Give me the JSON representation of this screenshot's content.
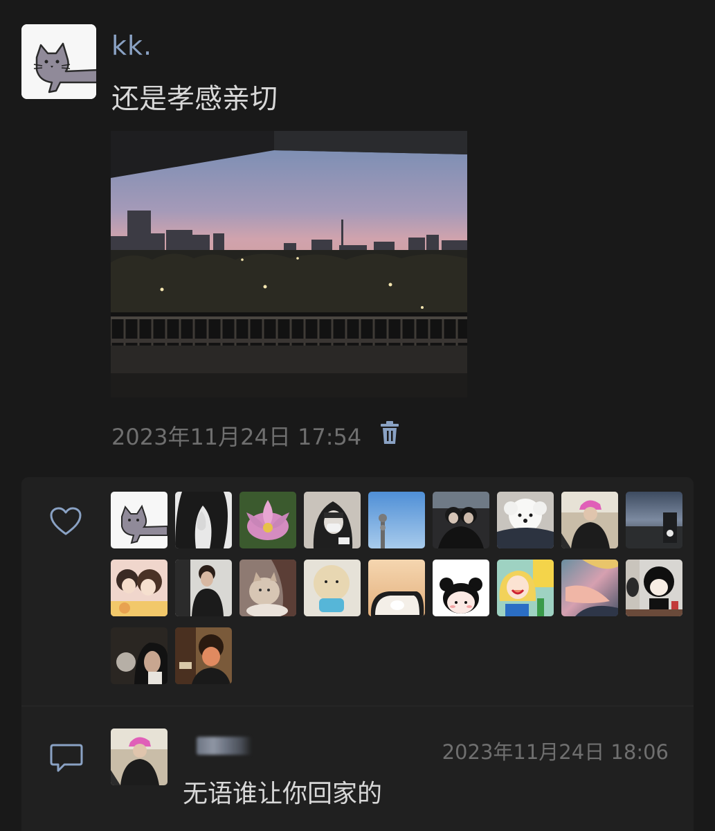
{
  "post": {
    "username": "kk.",
    "text": "还是孝感亲切",
    "timestamp": "2023年11月24日 17:54",
    "avatar_icon": "gray-cat-drawing-avatar",
    "photo": "sunset-city-skyline-photo"
  },
  "actions": {
    "delete_icon": "trash-icon",
    "accent_color": "#8aa2c4"
  },
  "likes": {
    "icon": "heart-icon",
    "avatars": [
      "gray-cat-drawing-avatar",
      "anime-dark-hair-avatar",
      "pink-lotus-avatar",
      "hooded-masked-person-avatar",
      "blue-sky-tower-avatar",
      "couple-photo-avatar",
      "white-puppy-avatar",
      "pink-hat-girl-avatar",
      "dusk-sky-avatar",
      "cartoon-couple-avatar",
      "young-man-avatar",
      "cat-and-girl-avatar",
      "round-toy-avatar",
      "car-mirror-avatar",
      "cartoon-girl-buns-avatar",
      "sailor-moon-avatar",
      "anime-glow-avatar",
      "black-hair-figure-avatar",
      "side-profile-avatar",
      "curly-hair-boy-avatar"
    ]
  },
  "comments": [
    {
      "icon": "comment-icon",
      "avatar": "pink-hat-girl-avatar",
      "time": "2023年11月24日 18:06",
      "text": "无语谁让你回家的"
    }
  ]
}
